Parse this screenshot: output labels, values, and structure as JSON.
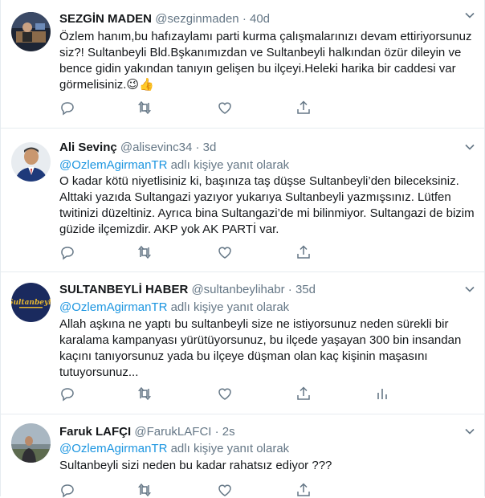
{
  "tweets": [
    {
      "name": "SEZGİN MADEN",
      "handle": "@sezginmaden",
      "separator": "·",
      "time": "40d",
      "replying": null,
      "lines": [
        "Özlem hanım,bu hafızaylamı parti kurma çalışmalarınızı devam ettiriyorsunuz",
        "siz?! Sultanbeyli Bld.Bşkanımızdan ve Sultanbeyli halkından özür dileyin ve",
        "bence gidin yakından tanıyın gelişen bu ilçeyi.Heleki harika bir caddesi var",
        "görmelisiniz.😉👍"
      ],
      "has_stats": false
    },
    {
      "name": "Ali Sevinç",
      "handle": "@alisevinc34",
      "separator": "·",
      "time": "3d",
      "replying": {
        "mention": "@OzlemAgirmanTR",
        "suffix": " adlı kişiye yanıt olarak"
      },
      "lines": [
        "O kadar kötü niyetlisiniz ki, başınıza taş düşse Sultanbeyli’den bileceksiniz.",
        "Alttaki yazıda Sultangazi yazıyor yukarıya Sultanbeyli yazmışsınız. Lütfen",
        "twitinizi düzeltiniz. Ayrıca bina Sultangazi’de mi bilinmiyor. Sultangazi de bizim",
        "güzide ilçemizdir. AKP yok AK PARTİ var."
      ],
      "has_stats": false
    },
    {
      "name": "SULTANBEYLİ HABER",
      "handle": "@sultanbeylihabr",
      "separator": "·",
      "time": "35d",
      "replying": {
        "mention": "@OzlemAgirmanTR",
        "suffix": " adlı kişiye yanıt olarak"
      },
      "lines": [
        "Allah aşkına ne yaptı bu sultanbeyli size ne istiyorsunuz neden sürekli bir",
        "karalama kampanyası yürütüyorsunuz,  bu ilçede yaşayan 300 bin insandan",
        "kaçını tanıyorsunuz yada bu ilçeye düşman olan kaç kişinin maşasını",
        "tutuyorsunuz..."
      ],
      "has_stats": true
    },
    {
      "name": "Faruk LAFÇI",
      "handle": "@FarukLAFCI",
      "separator": "·",
      "time": "2s",
      "replying": {
        "mention": "@OzlemAgirmanTR",
        "suffix": " adlı kişiye yanıt olarak"
      },
      "lines": [
        "Sultanbeyli sizi neden bu kadar rahatsız ediyor ???"
      ],
      "has_stats": false
    }
  ],
  "icons": {
    "reply": "reply-icon",
    "retweet": "retweet-icon",
    "like": "like-icon",
    "share": "share-icon",
    "stats": "analytics-icon",
    "menu": "chevron-down-icon"
  },
  "colors": {
    "text": "#14171a",
    "muted": "#657786",
    "link": "#1b95e0",
    "border": "#e6ecf0",
    "icon": "#657786"
  }
}
